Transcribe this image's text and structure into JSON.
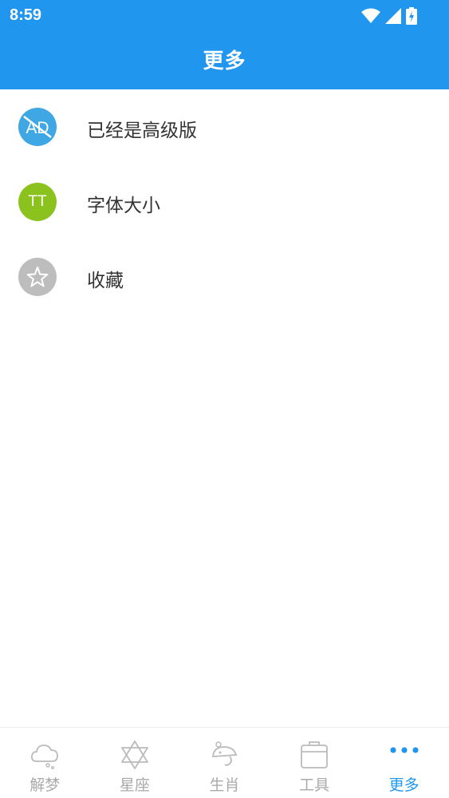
{
  "status_bar": {
    "time": "8:59"
  },
  "header": {
    "title": "更多"
  },
  "menu": {
    "items": [
      {
        "label": "已经是高级版",
        "icon_text": "AD",
        "icon": "no-ads-icon",
        "color": "#3fa7e3"
      },
      {
        "label": "字体大小",
        "icon_text": "TT",
        "icon": "font-size-icon",
        "color": "#8cc21e"
      },
      {
        "label": "收藏",
        "icon": "star-icon",
        "color": "#bdbdbd"
      }
    ]
  },
  "bottom_nav": {
    "items": [
      {
        "label": "解梦",
        "icon": "cloud-icon"
      },
      {
        "label": "星座",
        "icon": "hexagram-icon"
      },
      {
        "label": "生肖",
        "icon": "zodiac-icon"
      },
      {
        "label": "工具",
        "icon": "toolbox-icon"
      },
      {
        "label": "更多",
        "icon": "more-dots-icon",
        "active": true
      }
    ],
    "active_color": "#2196ee",
    "inactive_color": "#aaaaaa"
  },
  "colors": {
    "accent": "#2196ee"
  }
}
